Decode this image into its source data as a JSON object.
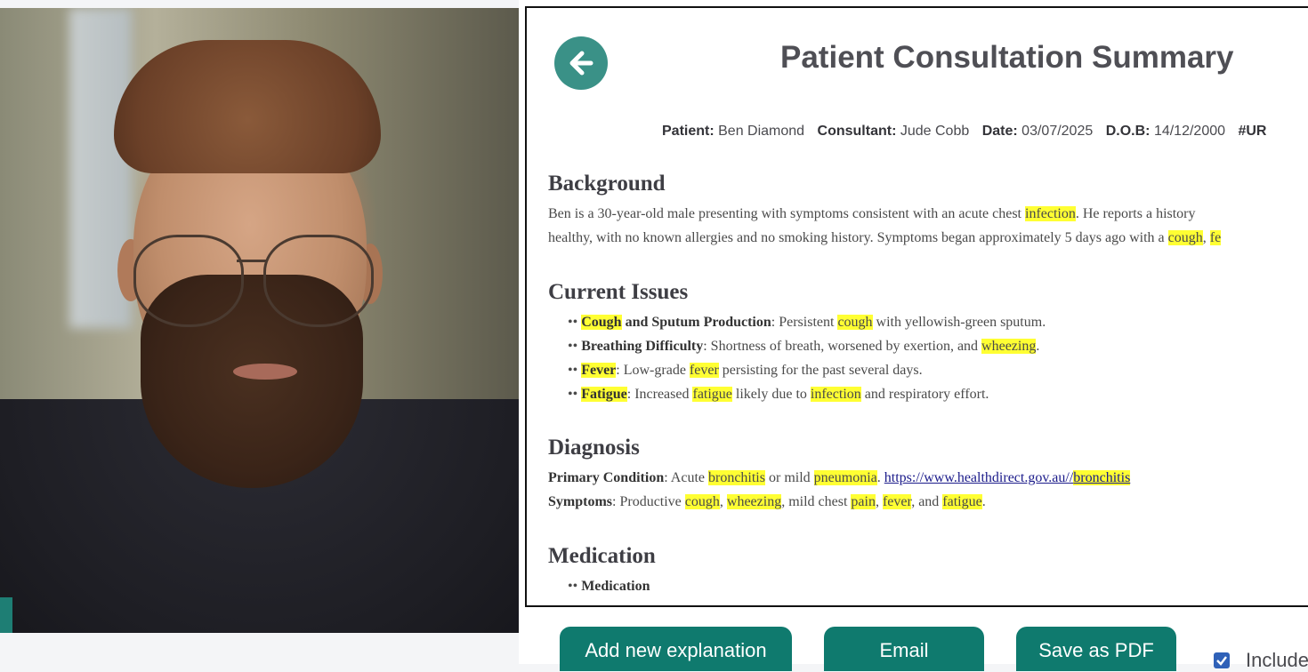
{
  "video": {
    "caption": ""
  },
  "document": {
    "title": "Patient Consultation Summary",
    "meta": {
      "patient_label": "Patient:",
      "patient": "Ben Diamond",
      "consultant_label": "Consultant:",
      "consultant": "Jude Cobb",
      "date_label": "Date:",
      "date": "03/07/2025",
      "dob_label": "D.O.B:",
      "dob": "14/12/2000",
      "ur_label": "#UR"
    },
    "background": {
      "heading": "Background",
      "line1_a": "Ben is a 30-year-old male presenting with symptoms consistent with an acute chest ",
      "line1_hl": "infection",
      "line1_b": ". He reports a history",
      "line2_a": "healthy, with no known allergies and no smoking history. Symptoms began approximately 5 days ago with a ",
      "line2_hl1": "cough",
      "line2_b": ", ",
      "line2_hl2": "fe"
    },
    "current_issues": {
      "heading": "Current Issues",
      "items": [
        {
          "hl_term": "Cough",
          "bold_rest": " and Sputum Production",
          "text_a": ": Persistent ",
          "hl2": "cough",
          "text_b": " with yellowish-green sputum."
        },
        {
          "bold": "Breathing Difficulty",
          "text_a": ": Shortness of breath, worsened by exertion, and ",
          "hl2": "wheezing",
          "text_b": "."
        },
        {
          "hl_term": "Fever",
          "text_a": ": Low-grade ",
          "hl2": "fever",
          "text_b": " persisting for the past several days."
        },
        {
          "hl_term": "Fatigue",
          "text_a": ": Increased ",
          "hl2": "fatigue",
          "text_b": " likely due to ",
          "hl3": "infection",
          "text_c": " and respiratory effort."
        }
      ],
      "bullet": "•• "
    },
    "diagnosis": {
      "heading": "Diagnosis",
      "primary_label": "Primary Condition",
      "primary_a": ": Acute ",
      "primary_hl1": "bronchitis",
      "primary_b": " or mild ",
      "primary_hl2": "pneumonia",
      "primary_c": ". ",
      "link_text": "https://www.healthdirect.gov.au//",
      "link_hl": "bronchitis",
      "symptoms_label": "Symptoms",
      "sym_a": ": Productive ",
      "sym_hl1": "cough",
      "sym_b": ", ",
      "sym_hl2": "wheezing",
      "sym_c": ", mild chest ",
      "sym_hl3": "pain",
      "sym_d": ", ",
      "sym_hl4": "fever",
      "sym_e": ", and ",
      "sym_hl5": "fatigue",
      "sym_f": "."
    },
    "medication": {
      "heading": "Medication",
      "bullet": "•• ",
      "item": "Medication"
    }
  },
  "actions": {
    "add_explanation": "Add new explanation",
    "email": "Email",
    "save_pdf": "Save as PDF",
    "include_label": "Include",
    "include_checked": true
  },
  "colors": {
    "teal_button": "#0f7a6e",
    "back_button": "#3a9187",
    "highlight": "#ffff33"
  }
}
